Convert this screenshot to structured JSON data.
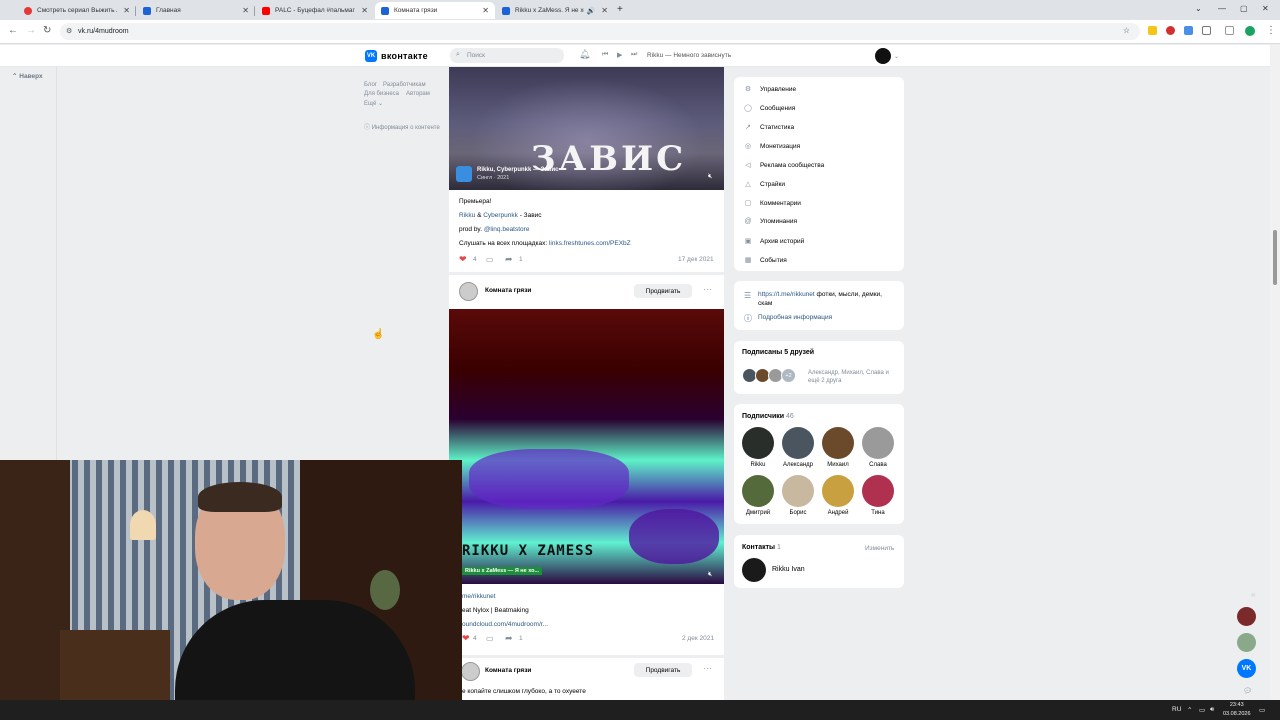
{
  "browser": {
    "tabs": [
      {
        "title": "Смотреть сериал Выжить любой...",
        "color": "#e53935"
      },
      {
        "title": "Главная",
        "color": "#1e63d6"
      },
      {
        "title": "PALC - Буцефал #пальмагофи...",
        "color": "#ff0000"
      },
      {
        "title": "Комната грязи",
        "color": "#1e63d6"
      },
      {
        "title": "Rikku x ZaMess. Я не хочу",
        "color": "#1e63d6"
      }
    ],
    "new_tab": "+",
    "url": "vk.ru/4mudroom"
  },
  "vk": {
    "logo_text": "вконтакте",
    "search_placeholder": "Поиск",
    "now_playing": "Rikku — Немного зависнуть"
  },
  "left": {
    "back": "Наверх",
    "links": [
      "Блог",
      "Разработчикам",
      "Для бизнеса",
      "Авторам",
      "Ещё"
    ],
    "content_info": "Информация о контенте"
  },
  "post1": {
    "video_overlay_title": "Rikku, Cyberpunkk — Завис",
    "video_overlay_sub": "Сингл · 2021",
    "image_title": "ЗАВИС",
    "lines": {
      "premiere": "Премьера!",
      "artist1": "Rikku",
      "amp": " & ",
      "artist2": "Cyberpunkk",
      "track": " - Завис",
      "prod": "prod by. ",
      "prod_link": "@linq.beatstore",
      "listen": "Слушать на всех площадках: ",
      "listen_link": "links.freshtunes.com/PEXbZ"
    },
    "likes": "4",
    "shares": "1",
    "date": "17 дек 2021"
  },
  "post2": {
    "author": "Комната грязи",
    "promote": "Продвигать",
    "image_title": "RIKKU X ZAMESS",
    "video_overlay_title": "Rikku x ZaMess — Я не хо...",
    "lines": {
      "l1": "me/rikkunet",
      "l2": "eat Nylox | Beatmaking",
      "l3": "oundcloud.com/4mudroom/r..."
    },
    "likes": "4",
    "shares": "1",
    "date": "2 дек 2021"
  },
  "post3": {
    "author": "Комната грязи",
    "promote": "Продвигать",
    "text": "е копайте слишком глубоко, а то охуеете"
  },
  "menu": [
    {
      "label": "Управление",
      "icon": "gear-icon",
      "glyph": "⚙"
    },
    {
      "label": "Сообщения",
      "icon": "message-icon",
      "glyph": "◯"
    },
    {
      "label": "Статистика",
      "icon": "stats-icon",
      "glyph": "↗"
    },
    {
      "label": "Монетизация",
      "icon": "coin-icon",
      "glyph": "◎"
    },
    {
      "label": "Реклама сообщества",
      "icon": "megaphone-icon",
      "glyph": "◁"
    },
    {
      "label": "Страйки",
      "icon": "warning-icon",
      "glyph": "△"
    },
    {
      "label": "Комментарии",
      "icon": "comment-icon",
      "glyph": "▢"
    },
    {
      "label": "Упоминания",
      "icon": "mention-icon",
      "glyph": "@"
    },
    {
      "label": "Архив историй",
      "icon": "archive-icon",
      "glyph": "▣"
    },
    {
      "label": "События",
      "icon": "calendar-icon",
      "glyph": "▦"
    }
  ],
  "info": {
    "link": "https://t.me/rikkunet",
    "link_tail": " фотки, мысли, демки, скам",
    "details": "Подробная информация"
  },
  "friends": {
    "title": "Подписаны 5 друзей",
    "names": "Александр, Михаил, Слава и ещё 2 друга",
    "more": "+2"
  },
  "subscribers": {
    "title": "Подписчики",
    "count": "46",
    "people": [
      {
        "name": "Rikku",
        "color": "#2a2e2a"
      },
      {
        "name": "Александр",
        "color": "#4a5560"
      },
      {
        "name": "Михаил",
        "color": "#6a4a2a"
      },
      {
        "name": "Слава",
        "color": "#9a9a9a"
      },
      {
        "name": "Дмитрий",
        "color": "#556a3a"
      },
      {
        "name": "Борис",
        "color": "#c8b8a0"
      },
      {
        "name": "Андрей",
        "color": "#c8a040"
      },
      {
        "name": "Тина",
        "color": "#b03050"
      }
    ]
  },
  "contacts": {
    "title": "Контакты",
    "count": "1",
    "edit": "Изменить",
    "name": "Rikku Ivan"
  },
  "taskbar": {
    "lang": "RU",
    "time": "23:43",
    "date": "03.08.2026"
  }
}
